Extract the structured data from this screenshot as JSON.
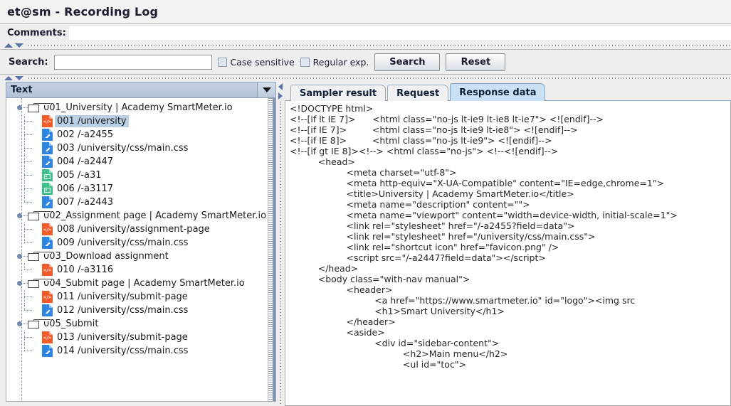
{
  "window": {
    "title": "et@sm - Recording Log"
  },
  "comments": {
    "label": "Comments:",
    "value": "",
    "placeholder": ""
  },
  "search": {
    "label": "Search:",
    "value": "",
    "placeholder": "",
    "case_sensitive_label": "Case sensitive",
    "case_sensitive_checked": false,
    "regex_label": "Regular exp.",
    "regex_checked": false,
    "search_button": "Search",
    "reset_button": "Reset"
  },
  "tree": {
    "column_header": "Text",
    "selected": "001 /university",
    "nodes": [
      {
        "type": "group",
        "label": "001_University | Academy SmartMeter.io",
        "icon": "folder-icon"
      },
      {
        "type": "leaf",
        "label": "001 /university",
        "icon": "html-file-icon",
        "color": "#f15a29",
        "selected": true,
        "last": false
      },
      {
        "type": "leaf",
        "label": "002 /-a2455",
        "icon": "css-file-icon",
        "color": "#2f86e0",
        "selected": false,
        "last": false
      },
      {
        "type": "leaf",
        "label": "003 /university/css/main.css",
        "icon": "css-file-icon",
        "color": "#2f86e0",
        "selected": false,
        "last": false
      },
      {
        "type": "leaf",
        "label": "004 /-a2447",
        "icon": "css-file-icon",
        "color": "#2f86e0",
        "selected": false,
        "last": false
      },
      {
        "type": "leaf",
        "label": "005 /-a31",
        "icon": "image-file-icon",
        "color": "#3fc08a",
        "selected": false,
        "last": false
      },
      {
        "type": "leaf",
        "label": "006 /-a3117",
        "icon": "image-file-icon",
        "color": "#3fc08a",
        "selected": false,
        "last": false
      },
      {
        "type": "leaf",
        "label": "007 /-a2443",
        "icon": "css-file-icon",
        "color": "#2f86e0",
        "selected": false,
        "last": true
      },
      {
        "type": "group",
        "label": "002_Assignment page | Academy SmartMeter.io",
        "icon": "folder-icon"
      },
      {
        "type": "leaf",
        "label": "008 /university/assignment-page",
        "icon": "html-file-icon",
        "color": "#f15a29",
        "selected": false,
        "last": false
      },
      {
        "type": "leaf",
        "label": "009 /university/css/main.css",
        "icon": "css-file-icon",
        "color": "#2f86e0",
        "selected": false,
        "last": true
      },
      {
        "type": "group",
        "label": "003_Download assignment",
        "icon": "folder-icon"
      },
      {
        "type": "leaf",
        "label": "010 /-a3116",
        "icon": "html-file-icon",
        "color": "#f15a29",
        "selected": false,
        "last": true
      },
      {
        "type": "group",
        "label": "004_Submit page | Academy SmartMeter.io",
        "icon": "folder-icon"
      },
      {
        "type": "leaf",
        "label": "011 /university/submit-page",
        "icon": "html-file-icon",
        "color": "#f15a29",
        "selected": false,
        "last": false
      },
      {
        "type": "leaf",
        "label": "012 /university/css/main.css",
        "icon": "css-file-icon",
        "color": "#2f86e0",
        "selected": false,
        "last": true
      },
      {
        "type": "group",
        "label": "005_Submit",
        "icon": "folder-icon"
      },
      {
        "type": "leaf",
        "label": "013 /university/submit-page",
        "icon": "html-file-icon",
        "color": "#f15a29",
        "selected": false,
        "last": false
      },
      {
        "type": "leaf",
        "label": "014 /university/css/main.css",
        "icon": "css-file-icon",
        "color": "#2f86e0",
        "selected": false,
        "last": true
      }
    ]
  },
  "result_panel": {
    "tabs": [
      {
        "label": "Sampler result",
        "active": false
      },
      {
        "label": "Request",
        "active": false
      },
      {
        "label": "Response data",
        "active": true
      }
    ],
    "response_lines": [
      "<!DOCTYPE html>",
      "<!--[if lt IE 7]>      <html class=\"no-js lt-ie9 lt-ie8 lt-ie7\"> <![endif]-->",
      "<!--[if IE 7]>         <html class=\"no-js lt-ie9 lt-ie8\"> <![endif]-->",
      "<!--[if IE 8]>         <html class=\"no-js lt-ie9\"> <![endif]-->",
      "<!--[if gt IE 8]><!--> <html class=\"no-js\"> <!--<![endif]-->",
      "          <head>",
      "                    <meta charset=\"utf-8\">",
      "                    <meta http-equiv=\"X-UA-Compatible\" content=\"IE=edge,chrome=1\">",
      "                    <title>University | Academy SmartMeter.io</title>",
      "                    <meta name=\"description\" content=\"\">",
      "                    <meta name=\"viewport\" content=\"width=device-width, initial-scale=1\">",
      "",
      "                    <link rel=\"stylesheet\" href=\"/-a2455?field=data\">",
      "                    <link rel=\"stylesheet\" href=\"/university/css/main.css\">",
      "",
      "                    <link rel=\"shortcut icon\" href=\"favicon.png\" />",
      "",
      "                    <script src=\"/-a2447?field=data\"></script>",
      "          </head>",
      "          <body class=\"with-nav manual\">",
      "                    <header>",
      "                              <a href=\"https://www.smartmeter.io\" id=\"logo\"><img src",
      "                              <h1>Smart University</h1>",
      "                    </header>",
      "                    <aside>",
      "",
      "                              <div id=\"sidebar-content\">",
      "                                        <h2>Main menu</h2>",
      "                                        <ul id=\"toc\">"
    ]
  },
  "colors": {
    "accent": "#5a73a8",
    "tab_active": "#c9e0f5",
    "selection": "#b9cfe4",
    "html_icon": "#f15a29",
    "css_icon": "#2f86e0",
    "image_icon": "#3fc08a"
  }
}
